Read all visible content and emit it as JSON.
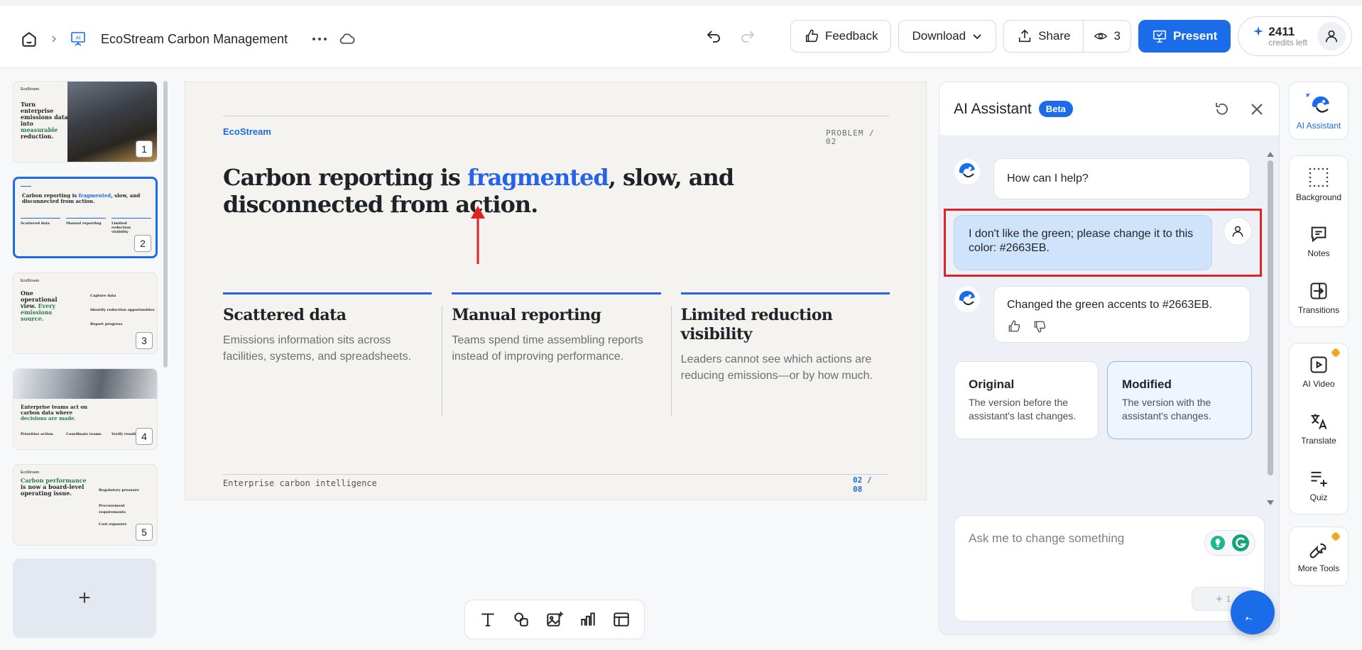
{
  "header": {
    "doc_title": "EcoStream Carbon Management",
    "feedback": "Feedback",
    "download": "Download",
    "share": "Share",
    "viewers": "3",
    "present": "Present",
    "credits": "2411",
    "credits_label": "credits left"
  },
  "thumbnails": [
    {
      "num": "1",
      "brand": "EcoStream",
      "title_a": "Turn enterprise emissions data into ",
      "title_b": "measurable",
      "title_c": " reduction."
    },
    {
      "num": "2",
      "brand": "EcoStream",
      "title_a": "Carbon reporting is ",
      "title_b": "fragmented",
      "title_c": ", slow, and disconnected from action.",
      "c1": "Scattered data",
      "c2": "Manual reporting",
      "c3": "Limited reduction visibility"
    },
    {
      "num": "3",
      "brand": "EcoStream",
      "title_a": "One operational view. ",
      "title_b": "Every emissions source.",
      "c1": "Capture data",
      "c2": "Identify reduction opportunities",
      "c3": "Report progress"
    },
    {
      "num": "4",
      "title_a": "Enterprise teams act on carbon data where ",
      "title_b": "decisions are made.",
      "c1": "Prioritize action",
      "c2": "Coordinate teams",
      "c3": "Verify results"
    },
    {
      "num": "5",
      "brand": "EcoStream",
      "title_a": "Carbon performance",
      "title_b": " is now a board-level operating issue.",
      "c1": "Regulatory pressure",
      "c2": "Procurement requirements",
      "c3": "Cost exposure"
    }
  ],
  "add_slide": "+",
  "slide": {
    "brand": "EcoStream",
    "eyebrow_1": "PROBLEM /",
    "eyebrow_2": "02",
    "title_a": "Carbon reporting is ",
    "title_hl": "fragmented",
    "title_b": ", slow, and disconnected from action.",
    "columns": [
      {
        "heading": "Scattered data",
        "body": "Emissions information sits across facilities, systems, and spreadsheets."
      },
      {
        "heading": "Manual reporting",
        "body": "Teams spend time assembling reports instead of improving performance."
      },
      {
        "heading": "Limited reduction visibility",
        "body": "Leaders cannot see which actions are reducing emissions—or by how much."
      }
    ],
    "footer": "Enterprise carbon intelligence",
    "page_1": "02 /",
    "page_2": "08",
    "accent": "#2663EB"
  },
  "assistant": {
    "title": "AI Assistant",
    "badge": "Beta",
    "greeting": "How can I help?",
    "user_msg": "I don't like the green; please change it to this color: #2663EB.",
    "reply": "Changed the green accents to #2663EB.",
    "original_title": "Original",
    "original_desc": "The version before the assistant's last changes.",
    "modified_title": "Modified",
    "modified_desc": "The version with the assistant's changes.",
    "input_placeholder": "Ask me to change something",
    "send_count": "1"
  },
  "rail": {
    "ai": "AI Assistant",
    "background": "Background",
    "notes": "Notes",
    "transitions": "Transitions",
    "ai_video": "AI Video",
    "translate": "Translate",
    "quiz": "Quiz",
    "more_tools": "More Tools"
  },
  "colors": {
    "primary": "#1a6ce8",
    "accent": "#2663EB",
    "highlight": "#e02424"
  }
}
